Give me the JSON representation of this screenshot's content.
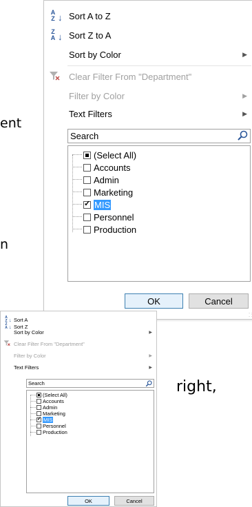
{
  "background_text": {
    "fragment_ent": "ent",
    "fragment_n": "n",
    "fragment_right": "right,"
  },
  "large_menu": {
    "sort_az": "Sort A to Z",
    "sort_za": "Sort Z to A",
    "sort_by_color": "Sort by Color",
    "clear_filter": "Clear Filter From \"Department\"",
    "filter_by_color": "Filter by Color",
    "text_filters": "Text Filters",
    "search_placeholder": "Search",
    "items": [
      {
        "label": "(Select All)",
        "state": "partial"
      },
      {
        "label": "Accounts",
        "state": "unchecked"
      },
      {
        "label": "Admin",
        "state": "unchecked"
      },
      {
        "label": "Marketing",
        "state": "unchecked"
      },
      {
        "label": "MIS",
        "state": "checked"
      },
      {
        "label": "Personnel",
        "state": "unchecked"
      },
      {
        "label": "Production",
        "state": "unchecked"
      }
    ],
    "ok_label": "OK",
    "cancel_label": "Cancel"
  },
  "small_menu": {
    "sort_az": "Sort A",
    "sort_za": "Sort Z",
    "sort_by_color": "Sort by Color",
    "clear_filter": "Clear Filter From \"Department\"",
    "filter_by_color": "Filter by Color",
    "text_filters": "Text Filters",
    "search_placeholder": "Search",
    "items": [
      {
        "label": "(Select All)",
        "state": "partial"
      },
      {
        "label": "Accounts",
        "state": "unchecked"
      },
      {
        "label": "Admin",
        "state": "unchecked"
      },
      {
        "label": "Marketing",
        "state": "unchecked"
      },
      {
        "label": "MIS",
        "state": "checked"
      },
      {
        "label": "Personnel",
        "state": "unchecked"
      },
      {
        "label": "Production",
        "state": "unchecked"
      }
    ],
    "ok_label": "OK",
    "cancel_label": "Cancel"
  },
  "colors": {
    "accent": "#2b579a",
    "selection": "#3399ff",
    "disabled_text": "#a0a0a0"
  }
}
